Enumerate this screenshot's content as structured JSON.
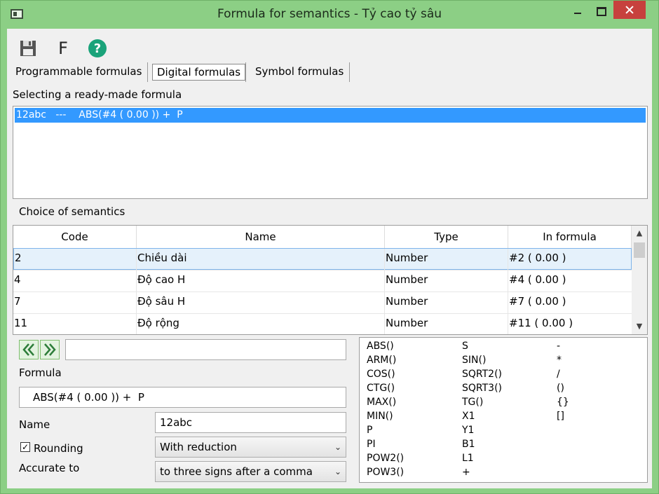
{
  "window": {
    "title": "Formula for semantics - Tỷ cao tỷ sâu"
  },
  "toolbar": {
    "f_label": "F"
  },
  "tabs": [
    {
      "label": "Programmable formulas"
    },
    {
      "label": "Digital formulas",
      "active": true
    },
    {
      "label": "Symbol formulas"
    }
  ],
  "ready_made": {
    "label": "Selecting a ready-made formula",
    "items": [
      "12abc   ---    ABS(#4 ( 0.00 )) +  P"
    ]
  },
  "semantics": {
    "label": "Choice of semantics",
    "columns": [
      "Code",
      "Name",
      "Type",
      "In formula"
    ],
    "rows": [
      [
        "2",
        "Chiều dài",
        "Number",
        "#2 ( 0.00 )"
      ],
      [
        "4",
        "Độ cao H",
        "Number",
        "#4 ( 0.00 )"
      ],
      [
        "7",
        "Độ sâu H",
        "Number",
        "#7 ( 0.00 )"
      ],
      [
        "11",
        "Độ rộng",
        "Number",
        "#11 ( 0.00 )"
      ]
    ]
  },
  "editor": {
    "search_value": "",
    "formula_label": "Formula",
    "formula_value": "ABS(#4 ( 0.00 )) +  P",
    "name_label": "Name",
    "name_value": "12abc",
    "rounding_label": "Rounding",
    "rounding_checked": true,
    "rounding_value": "With reduction",
    "accuracy_label": "Accurate to",
    "accuracy_value": "to three signs after a comma"
  },
  "functions": {
    "col1": [
      "ABS()",
      "ARM()",
      "COS()",
      "CTG()",
      "MAX()",
      "MIN()",
      "P",
      "PI",
      "POW2()",
      "POW3()"
    ],
    "col2": [
      "S",
      "SIN()",
      "SQRT2()",
      "SQRT3()",
      "TG()",
      "X1",
      "Y1",
      "B1",
      "L1",
      "+"
    ],
    "col3": [
      "-",
      "*",
      "/",
      "()",
      "{}",
      "[]"
    ]
  },
  "colors": {
    "frame": "#8ccf85",
    "selection": "#3399ff",
    "close_button": "#c7413d"
  },
  "icons": [
    "save-icon",
    "help-icon",
    "double-chevron-left-icon",
    "double-chevron-right-icon"
  ]
}
